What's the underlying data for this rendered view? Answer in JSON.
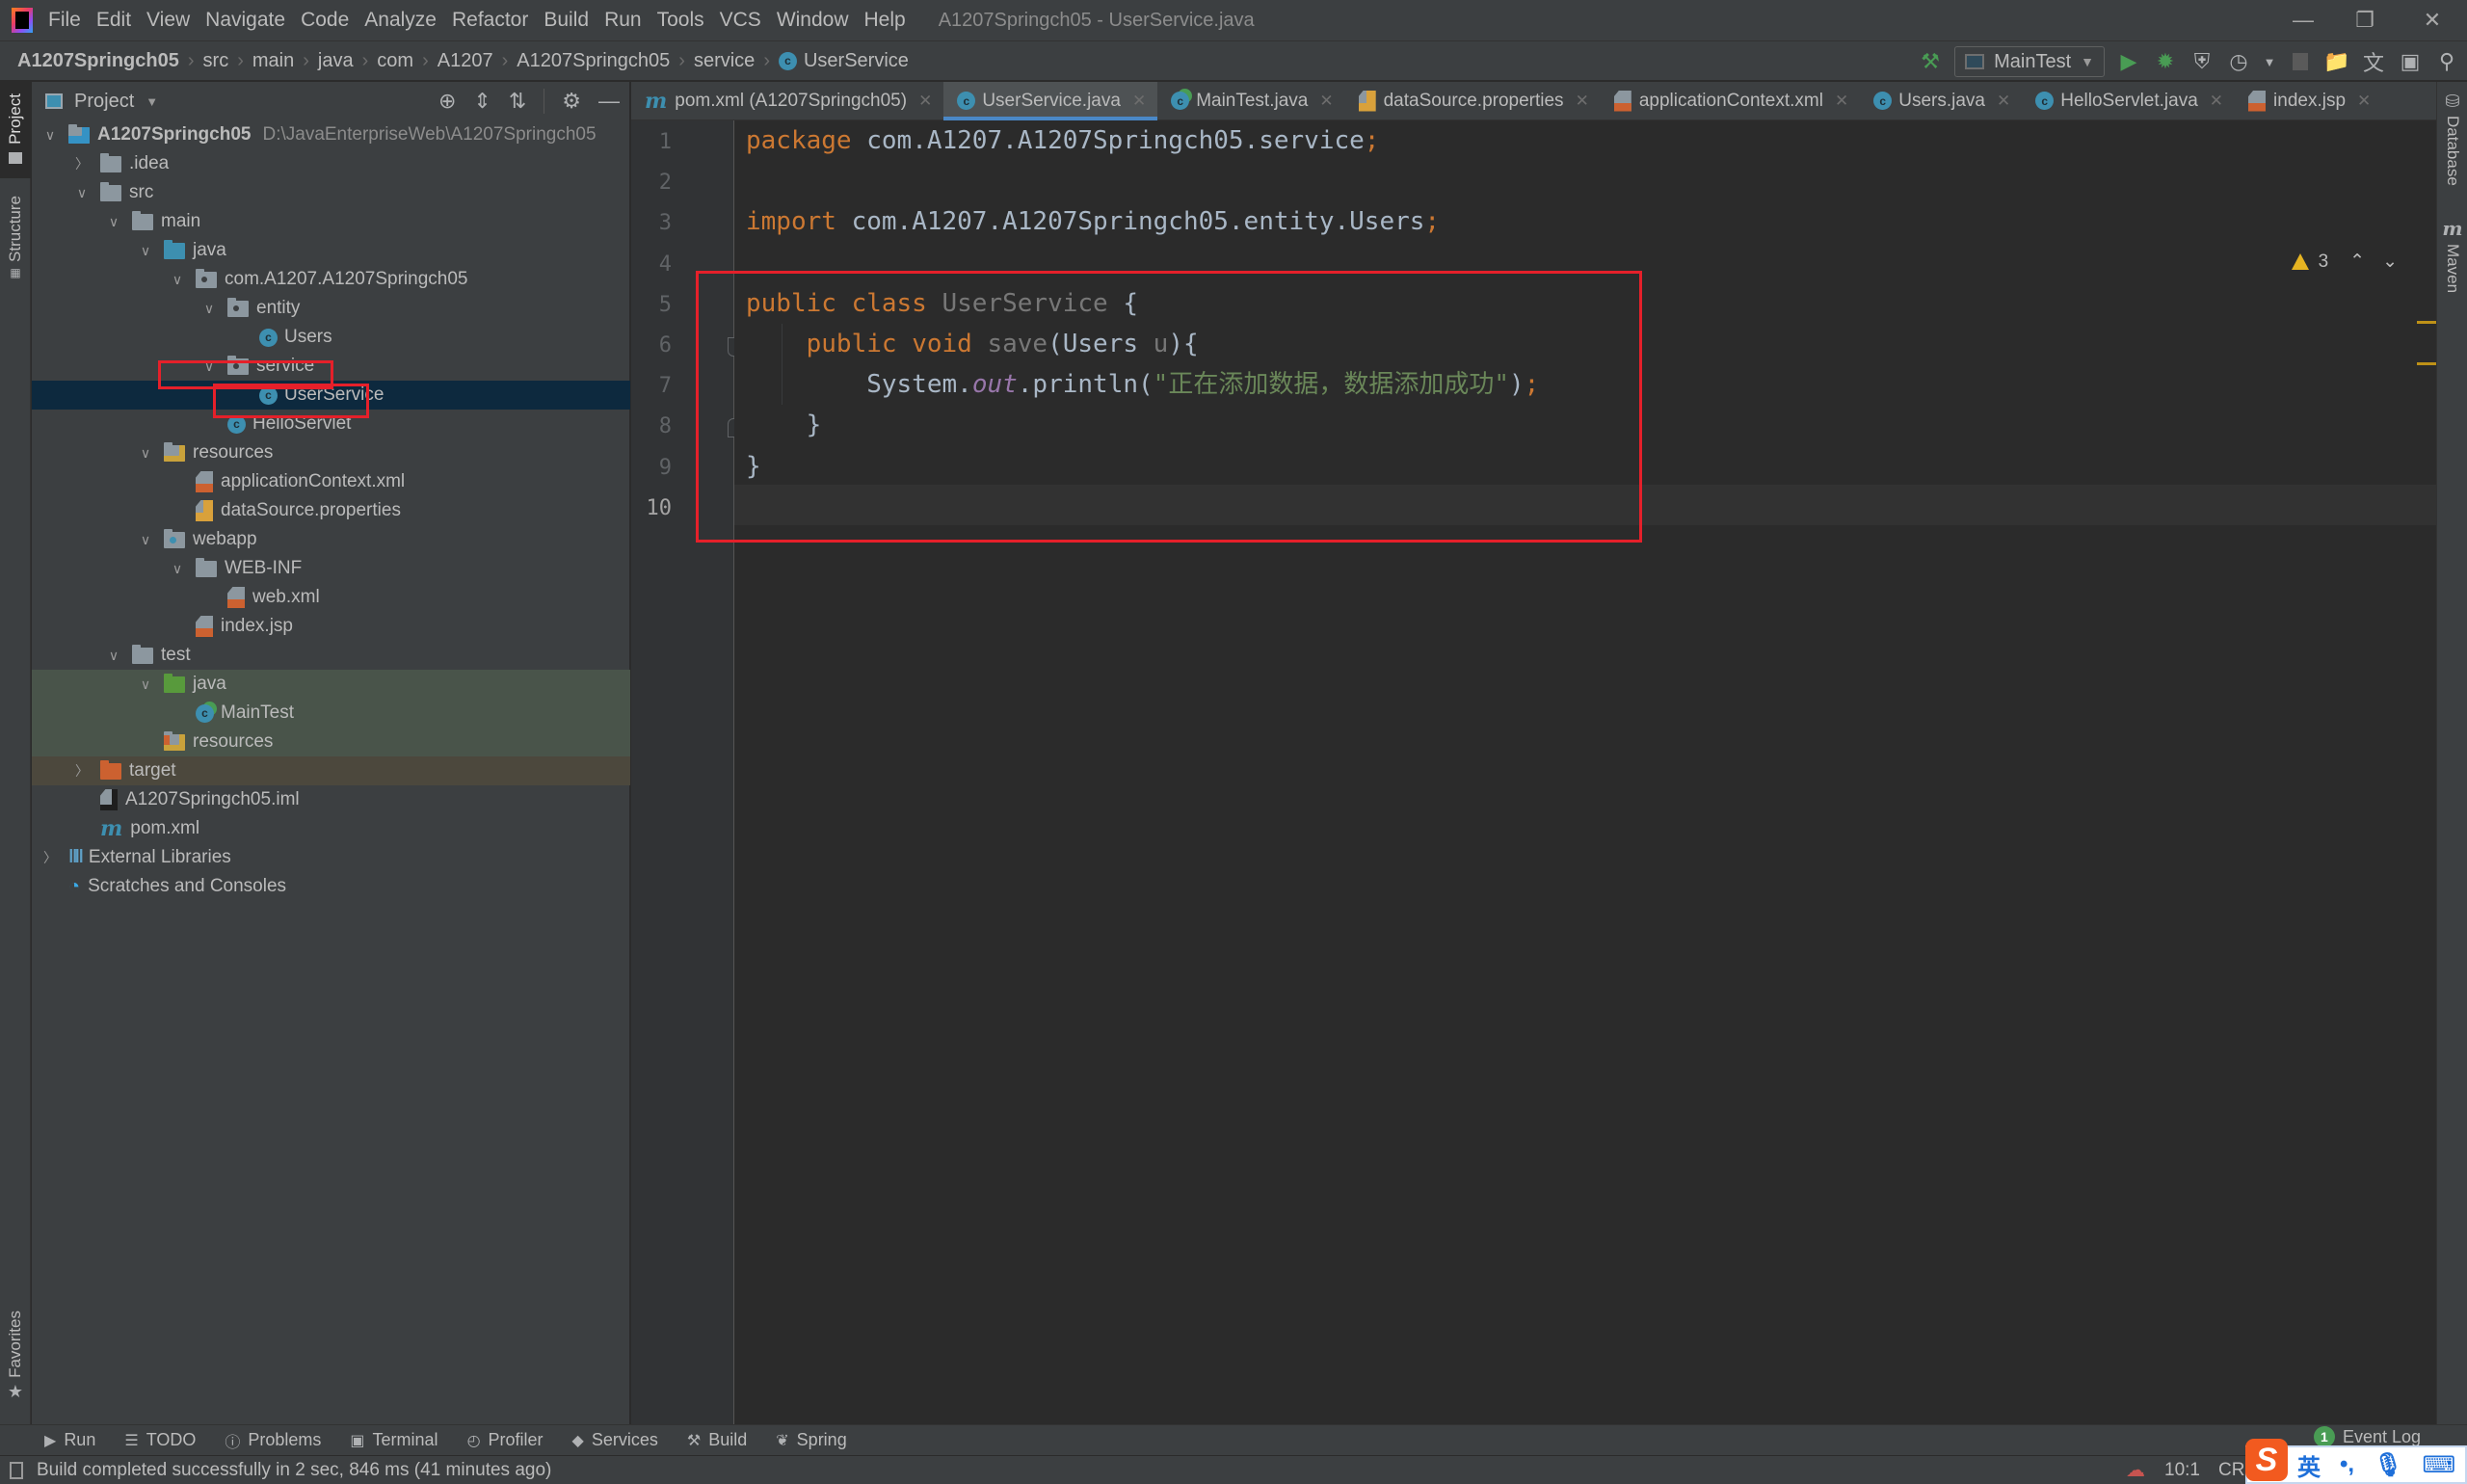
{
  "window": {
    "title": "A1207Springch05 - UserService.java",
    "controls": [
      "minimize",
      "restore",
      "close"
    ]
  },
  "menu": [
    "File",
    "Edit",
    "View",
    "Navigate",
    "Code",
    "Analyze",
    "Refactor",
    "Build",
    "Run",
    "Tools",
    "VCS",
    "Window",
    "Help"
  ],
  "breadcrumb": [
    "A1207Springch05",
    "src",
    "main",
    "java",
    "com",
    "A1207",
    "A1207Springch05",
    "service",
    "UserService"
  ],
  "toolbar": {
    "run_config": "MainTest",
    "icons": [
      "build-hammer-icon",
      "run-icon",
      "debug-icon",
      "coverage-icon",
      "profile-icon",
      "stop-icon",
      "project-structure-icon",
      "translate-icon",
      "run-anything-icon",
      "search-everywhere-icon"
    ]
  },
  "left_stripe": {
    "project": "Project",
    "structure": "Structure",
    "favorites": "Favorites"
  },
  "right_stripe": {
    "database": "Database",
    "maven": "Maven"
  },
  "project_panel": {
    "title": "Project",
    "tree": [
      {
        "label": "A1207Springch05",
        "path": "D:\\JavaEnterpriseWeb\\A1207Springch05",
        "depth": 0,
        "expanded": true,
        "icon": "module"
      },
      {
        "label": ".idea",
        "depth": 1,
        "expanded": false,
        "icon": "folder"
      },
      {
        "label": "src",
        "depth": 1,
        "expanded": true,
        "icon": "folder"
      },
      {
        "label": "main",
        "depth": 2,
        "expanded": true,
        "icon": "folder"
      },
      {
        "label": "java",
        "depth": 3,
        "expanded": true,
        "icon": "source-folder"
      },
      {
        "label": "com.A1207.A1207Springch05",
        "depth": 4,
        "expanded": true,
        "icon": "package"
      },
      {
        "label": "entity",
        "depth": 5,
        "expanded": true,
        "icon": "package"
      },
      {
        "label": "Users",
        "depth": 6,
        "icon": "class"
      },
      {
        "label": "service",
        "depth": 5,
        "expanded": true,
        "icon": "package",
        "highlighted": true
      },
      {
        "label": "UserService",
        "depth": 6,
        "icon": "class",
        "selected": true,
        "highlighted": true
      },
      {
        "label": "HelloServlet",
        "depth": 5,
        "icon": "class"
      },
      {
        "label": "resources",
        "depth": 3,
        "expanded": true,
        "icon": "resources-folder"
      },
      {
        "label": "applicationContext.xml",
        "depth": 4,
        "icon": "spring-xml"
      },
      {
        "label": "dataSource.properties",
        "depth": 4,
        "icon": "properties"
      },
      {
        "label": "webapp",
        "depth": 3,
        "expanded": true,
        "icon": "web-folder"
      },
      {
        "label": "WEB-INF",
        "depth": 4,
        "expanded": true,
        "icon": "folder"
      },
      {
        "label": "web.xml",
        "depth": 5,
        "icon": "web-xml"
      },
      {
        "label": "index.jsp",
        "depth": 4,
        "icon": "jsp"
      },
      {
        "label": "test",
        "depth": 2,
        "expanded": true,
        "icon": "folder"
      },
      {
        "label": "java",
        "depth": 3,
        "expanded": true,
        "icon": "test-folder",
        "test": true
      },
      {
        "label": "MainTest",
        "depth": 4,
        "icon": "test-class",
        "test": true
      },
      {
        "label": "resources",
        "depth": 3,
        "icon": "test-resources",
        "test": true
      },
      {
        "label": "target",
        "depth": 1,
        "expanded": false,
        "icon": "excluded-folder",
        "excluded": true
      },
      {
        "label": "A1207Springch05.iml",
        "depth": 1,
        "icon": "iml"
      },
      {
        "label": "pom.xml",
        "depth": 1,
        "icon": "maven"
      },
      {
        "label": "External Libraries",
        "depth": 0,
        "expanded": false,
        "icon": "libraries"
      },
      {
        "label": "Scratches and Consoles",
        "depth": 0,
        "icon": "scratches"
      }
    ]
  },
  "editor_tabs": [
    {
      "label": "pom.xml (A1207Springch05)",
      "icon": "maven"
    },
    {
      "label": "UserService.java",
      "icon": "class",
      "active": true
    },
    {
      "label": "MainTest.java",
      "icon": "test-class"
    },
    {
      "label": "dataSource.properties",
      "icon": "properties"
    },
    {
      "label": "applicationContext.xml",
      "icon": "spring-xml"
    },
    {
      "label": "Users.java",
      "icon": "class"
    },
    {
      "label": "HelloServlet.java",
      "icon": "class"
    },
    {
      "label": "index.jsp",
      "icon": "jsp"
    }
  ],
  "inspections": {
    "warnings": "3"
  },
  "editor": {
    "line_numbers": [
      "1",
      "2",
      "3",
      "4",
      "5",
      "6",
      "7",
      "8",
      "9",
      "10"
    ],
    "current_line": "10",
    "lines": [
      [
        {
          "t": "package",
          "c": "kw"
        },
        {
          "t": " com.A1207.A1207Springch05.service"
        },
        {
          "t": ";",
          "c": "kw"
        }
      ],
      [],
      [
        {
          "t": "import",
          "c": "kw"
        },
        {
          "t": " com.A1207.A1207Springch05.entity.Users"
        },
        {
          "t": ";",
          "c": "kw"
        }
      ],
      [],
      [
        {
          "t": "public class",
          "c": "kw"
        },
        {
          "t": " "
        },
        {
          "t": "UserService",
          "c": "cls-decl"
        },
        {
          "t": " {"
        }
      ],
      [
        {
          "t": "    "
        },
        {
          "t": "public void",
          "c": "kw"
        },
        {
          "t": " "
        },
        {
          "t": "save",
          "c": "unused"
        },
        {
          "t": "(Users "
        },
        {
          "t": "u",
          "c": "unused"
        },
        {
          "t": "){"
        }
      ],
      [
        {
          "t": "        System."
        },
        {
          "t": "out",
          "c": "fld"
        },
        {
          "t": ".println("
        },
        {
          "t": "\"正在添加数据，数据添加成功\"",
          "c": "str"
        },
        {
          "t": ")"
        },
        {
          "t": ";",
          "c": "kw"
        }
      ],
      [
        {
          "t": "    }"
        }
      ],
      [
        {
          "t": "}"
        }
      ],
      []
    ]
  },
  "bottom_tools": [
    {
      "label": "Run",
      "icon": "run-icon"
    },
    {
      "label": "TODO",
      "icon": "todo-icon"
    },
    {
      "label": "Problems",
      "icon": "problems-icon"
    },
    {
      "label": "Terminal",
      "icon": "terminal-icon"
    },
    {
      "label": "Profiler",
      "icon": "profiler-icon"
    },
    {
      "label": "Services",
      "icon": "services-icon"
    },
    {
      "label": "Build",
      "icon": "build-icon"
    },
    {
      "label": "Spring",
      "icon": "spring-icon"
    }
  ],
  "event_log": {
    "label": "Event Log",
    "count": "1"
  },
  "status": {
    "message": "Build completed successfully in 2 sec, 846 ms (41 minutes ago)",
    "caret": "10:1",
    "line_sep": "CRL"
  },
  "ime": {
    "mode": "英",
    "punct": "•,"
  },
  "colors": {
    "keyword": "#cc7832",
    "string": "#6a8759",
    "field": "#9876aa",
    "default": "#a9b7c6",
    "annotation_box": "#e5202a",
    "selection": "#0d293e",
    "accent": "#4a88c7"
  }
}
